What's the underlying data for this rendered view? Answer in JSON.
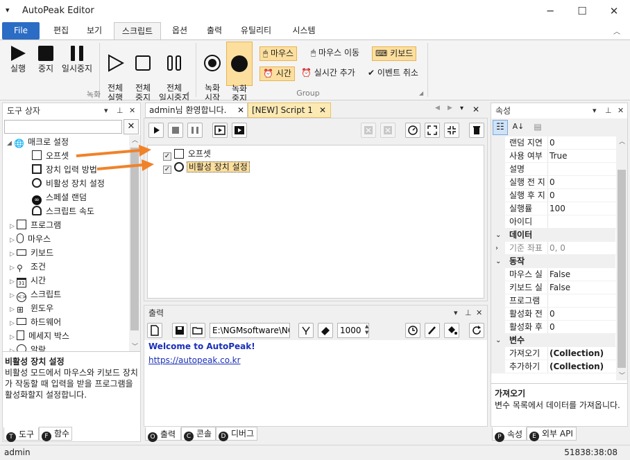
{
  "window": {
    "title": "AutoPeak Editor",
    "qat_glyph": "▾"
  },
  "menu": {
    "tabs": [
      "File",
      "편집",
      "보기",
      "스크립트",
      "옵션",
      "출력",
      "유틸리티",
      "시스템"
    ],
    "selected": "스크립트"
  },
  "ribbon": {
    "rec_group": {
      "label": "녹화",
      "buttons": [
        "실행",
        "중지",
        "일시중지",
        "전체\n실행",
        "전체\n중지",
        "전체\n일시중지"
      ]
    },
    "group": {
      "label": "Group",
      "big_buttons": [
        "녹화\n시작",
        "녹화\n중지"
      ],
      "small_buttons": [
        "마우스",
        "마우스 이동",
        "키보드",
        "시간",
        "실시간 추가",
        "이벤트 취소"
      ]
    }
  },
  "toolbox": {
    "title": "도구 상자",
    "search_placeholder": "",
    "tree": [
      {
        "label": "매크로 설정",
        "level": 0,
        "expanded": true,
        "icon": "globe-icon"
      },
      {
        "label": "오프셋",
        "level": 1,
        "icon": "offset-icon"
      },
      {
        "label": "장치 입력 방법",
        "level": 1,
        "icon": "device-icon"
      },
      {
        "label": "비활성 장치 설정",
        "level": 1,
        "icon": "crosshair-icon"
      },
      {
        "label": "스페셜 랜덤",
        "level": 1,
        "icon": "infinity-icon"
      },
      {
        "label": "스크립트 속도",
        "level": 1,
        "icon": "speed-icon"
      },
      {
        "label": "프로그램",
        "level": 0,
        "icon": "program-icon"
      },
      {
        "label": "마우스",
        "level": 0,
        "icon": "mouse-icon"
      },
      {
        "label": "키보드",
        "level": 0,
        "icon": "keyboard-icon"
      },
      {
        "label": "조건",
        "level": 0,
        "icon": "condition-icon"
      },
      {
        "label": "시간",
        "level": 0,
        "icon": "calendar-icon"
      },
      {
        "label": "스크립트",
        "level": 0,
        "icon": "script-icon"
      },
      {
        "label": "윈도우",
        "level": 0,
        "icon": "windows-icon"
      },
      {
        "label": "하드웨어",
        "level": 0,
        "icon": "hardware-icon"
      },
      {
        "label": "메세지 박스",
        "level": 0,
        "icon": "message-icon"
      },
      {
        "label": "알람",
        "level": 0,
        "icon": "alarm-icon"
      }
    ],
    "desc_title": "비활성 장치 설정",
    "desc_text": "비활성 모드에서 마우스와 키보드 장치가 작동할 때 입력을 받을 프로그램을 활성화할지 설정합니다.",
    "tabs": [
      "도구",
      "함수"
    ]
  },
  "doc_tabs": [
    "admin님 환영합니다.",
    "[NEW] Script 1"
  ],
  "script": {
    "lines": [
      {
        "text": "오프셋",
        "checked": true,
        "selected": false
      },
      {
        "text": "비활성 장치 설정",
        "checked": true,
        "selected": true
      }
    ]
  },
  "output": {
    "title": "출력",
    "path_value": "E:\\NGMsoftware\\NG",
    "count_value": "1000",
    "lines": [
      "Welcome to AutoPeak!",
      "https://autopeak.co.kr"
    ],
    "tabs": [
      "출력",
      "콘솔",
      "디버그"
    ]
  },
  "properties": {
    "title": "속성",
    "rows": [
      {
        "name": "랜덤 지연",
        "value": "0",
        "type": "prop"
      },
      {
        "name": "사용 여부",
        "value": "True",
        "type": "prop"
      },
      {
        "name": "설명",
        "value": "",
        "type": "prop"
      },
      {
        "name": "실행 전 지",
        "value": "0",
        "type": "prop"
      },
      {
        "name": "실행 후 지",
        "value": "0",
        "type": "prop"
      },
      {
        "name": "실행률",
        "value": "100",
        "type": "prop"
      },
      {
        "name": "아이디",
        "value": "",
        "type": "prop"
      },
      {
        "name": "데이터",
        "value": "",
        "type": "cat"
      },
      {
        "name": "기준 좌표",
        "value": "0, 0",
        "type": "sub"
      },
      {
        "name": "동작",
        "value": "",
        "type": "cat"
      },
      {
        "name": "마우스 실",
        "value": "False",
        "type": "prop"
      },
      {
        "name": "키보드 실",
        "value": "False",
        "type": "prop"
      },
      {
        "name": "프로그램",
        "value": "",
        "type": "prop"
      },
      {
        "name": "활성화 전",
        "value": "0",
        "type": "prop"
      },
      {
        "name": "활성화 후",
        "value": "0",
        "type": "prop"
      },
      {
        "name": "변수",
        "value": "",
        "type": "cat"
      },
      {
        "name": "가져오기",
        "value": "(Collection)",
        "type": "bold"
      },
      {
        "name": "추가하기",
        "value": "(Collection)",
        "type": "bold"
      }
    ],
    "desc_title": "가져오기",
    "desc_text": "변수 목록에서 데이터를 가져옵니다.",
    "tabs": [
      "속성",
      "외부 API"
    ]
  },
  "status": {
    "user": "admin",
    "time": "51838:38:08"
  },
  "colors": {
    "accent": "#2b6cc4",
    "highlight": "#fcdf9e",
    "arrow": "#f0822a"
  }
}
